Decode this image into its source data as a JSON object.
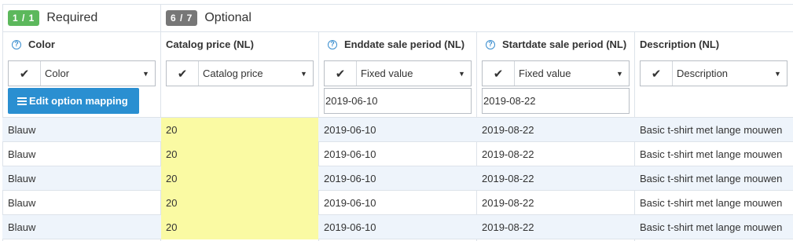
{
  "groups": {
    "required": {
      "badge": "1 / 1",
      "title": "Required"
    },
    "optional": {
      "badge": "6 / 7",
      "title": "Optional"
    }
  },
  "columns": [
    {
      "label": "Color",
      "help": "?",
      "select": "Color"
    },
    {
      "label": "Catalog price (NL)",
      "help": "",
      "select": "Catalog price"
    },
    {
      "label": "Enddate sale period (NL)",
      "help": "?",
      "select": "Fixed value",
      "input": "2019-06-10"
    },
    {
      "label": "Startdate sale period (NL)",
      "help": "?",
      "select": "Fixed value",
      "input": "2019-08-22"
    },
    {
      "label": "Description (NL)",
      "help": "",
      "select": "Description"
    }
  ],
  "edit_button": {
    "label": "Edit option mapping"
  },
  "check_glyph": "✔",
  "caret_glyph": "▼",
  "rows": [
    {
      "color": "Blauw",
      "price": "20",
      "enddate": "2019-06-10",
      "startdate": "2019-08-22",
      "description": "Basic t-shirt met lange mouwen"
    },
    {
      "color": "Blauw",
      "price": "20",
      "enddate": "2019-06-10",
      "startdate": "2019-08-22",
      "description": "Basic t-shirt met lange mouwen"
    },
    {
      "color": "Blauw",
      "price": "20",
      "enddate": "2019-06-10",
      "startdate": "2019-08-22",
      "description": "Basic t-shirt met lange mouwen"
    },
    {
      "color": "Blauw",
      "price": "20",
      "enddate": "2019-06-10",
      "startdate": "2019-08-22",
      "description": "Basic t-shirt met lange mouwen"
    },
    {
      "color": "Blauw",
      "price": "20",
      "enddate": "2019-06-10",
      "startdate": "2019-08-22",
      "description": "Basic t-shirt met lange mouwen"
    }
  ],
  "colors": {
    "required_badge": "#5cb85c",
    "optional_badge": "#777777",
    "button": "#2a8fd1",
    "price_highlight": "#fafaa3",
    "help_icon": "#3a8ecf"
  }
}
